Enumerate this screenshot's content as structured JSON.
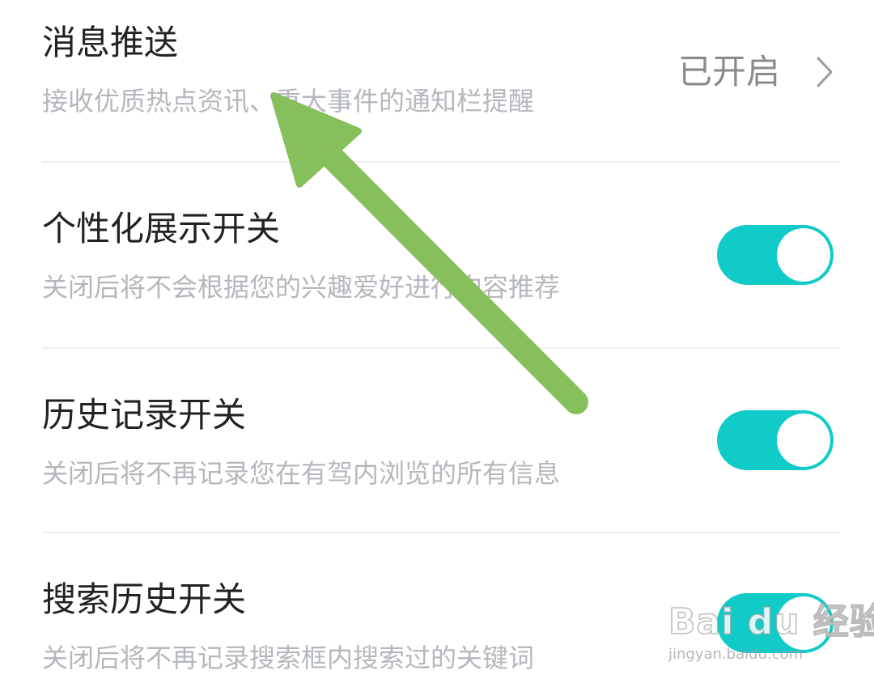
{
  "settings": [
    {
      "title": "消息推送",
      "description": "接收优质热点资讯、重大事件的通知栏提醒",
      "control": "link",
      "value": "已开启"
    },
    {
      "title": "个性化展示开关",
      "description": "关闭后将不会根据您的兴趣爱好进行内容推荐",
      "control": "toggle",
      "on": true
    },
    {
      "title": "历史记录开关",
      "description": "关闭后将不再记录您在有驾内浏览的所有信息",
      "control": "toggle",
      "on": true
    },
    {
      "title": "搜索历史开关",
      "description": "关闭后将不再记录搜索框内搜索过的关键词",
      "control": "toggle",
      "on": true
    }
  ],
  "watermark": {
    "logo": "Bai du 经验",
    "url": "jingyan.baidu.com"
  },
  "colors": {
    "toggle_on": "#10cbc7",
    "title_text": "#222222",
    "desc_text": "#b4b8bd",
    "value_text": "#8a8a8a",
    "annotation_arrow": "#86c05d"
  },
  "icons": {
    "value_chevron": "chevron-right-icon",
    "annotation": "arrow-annotation-icon"
  }
}
